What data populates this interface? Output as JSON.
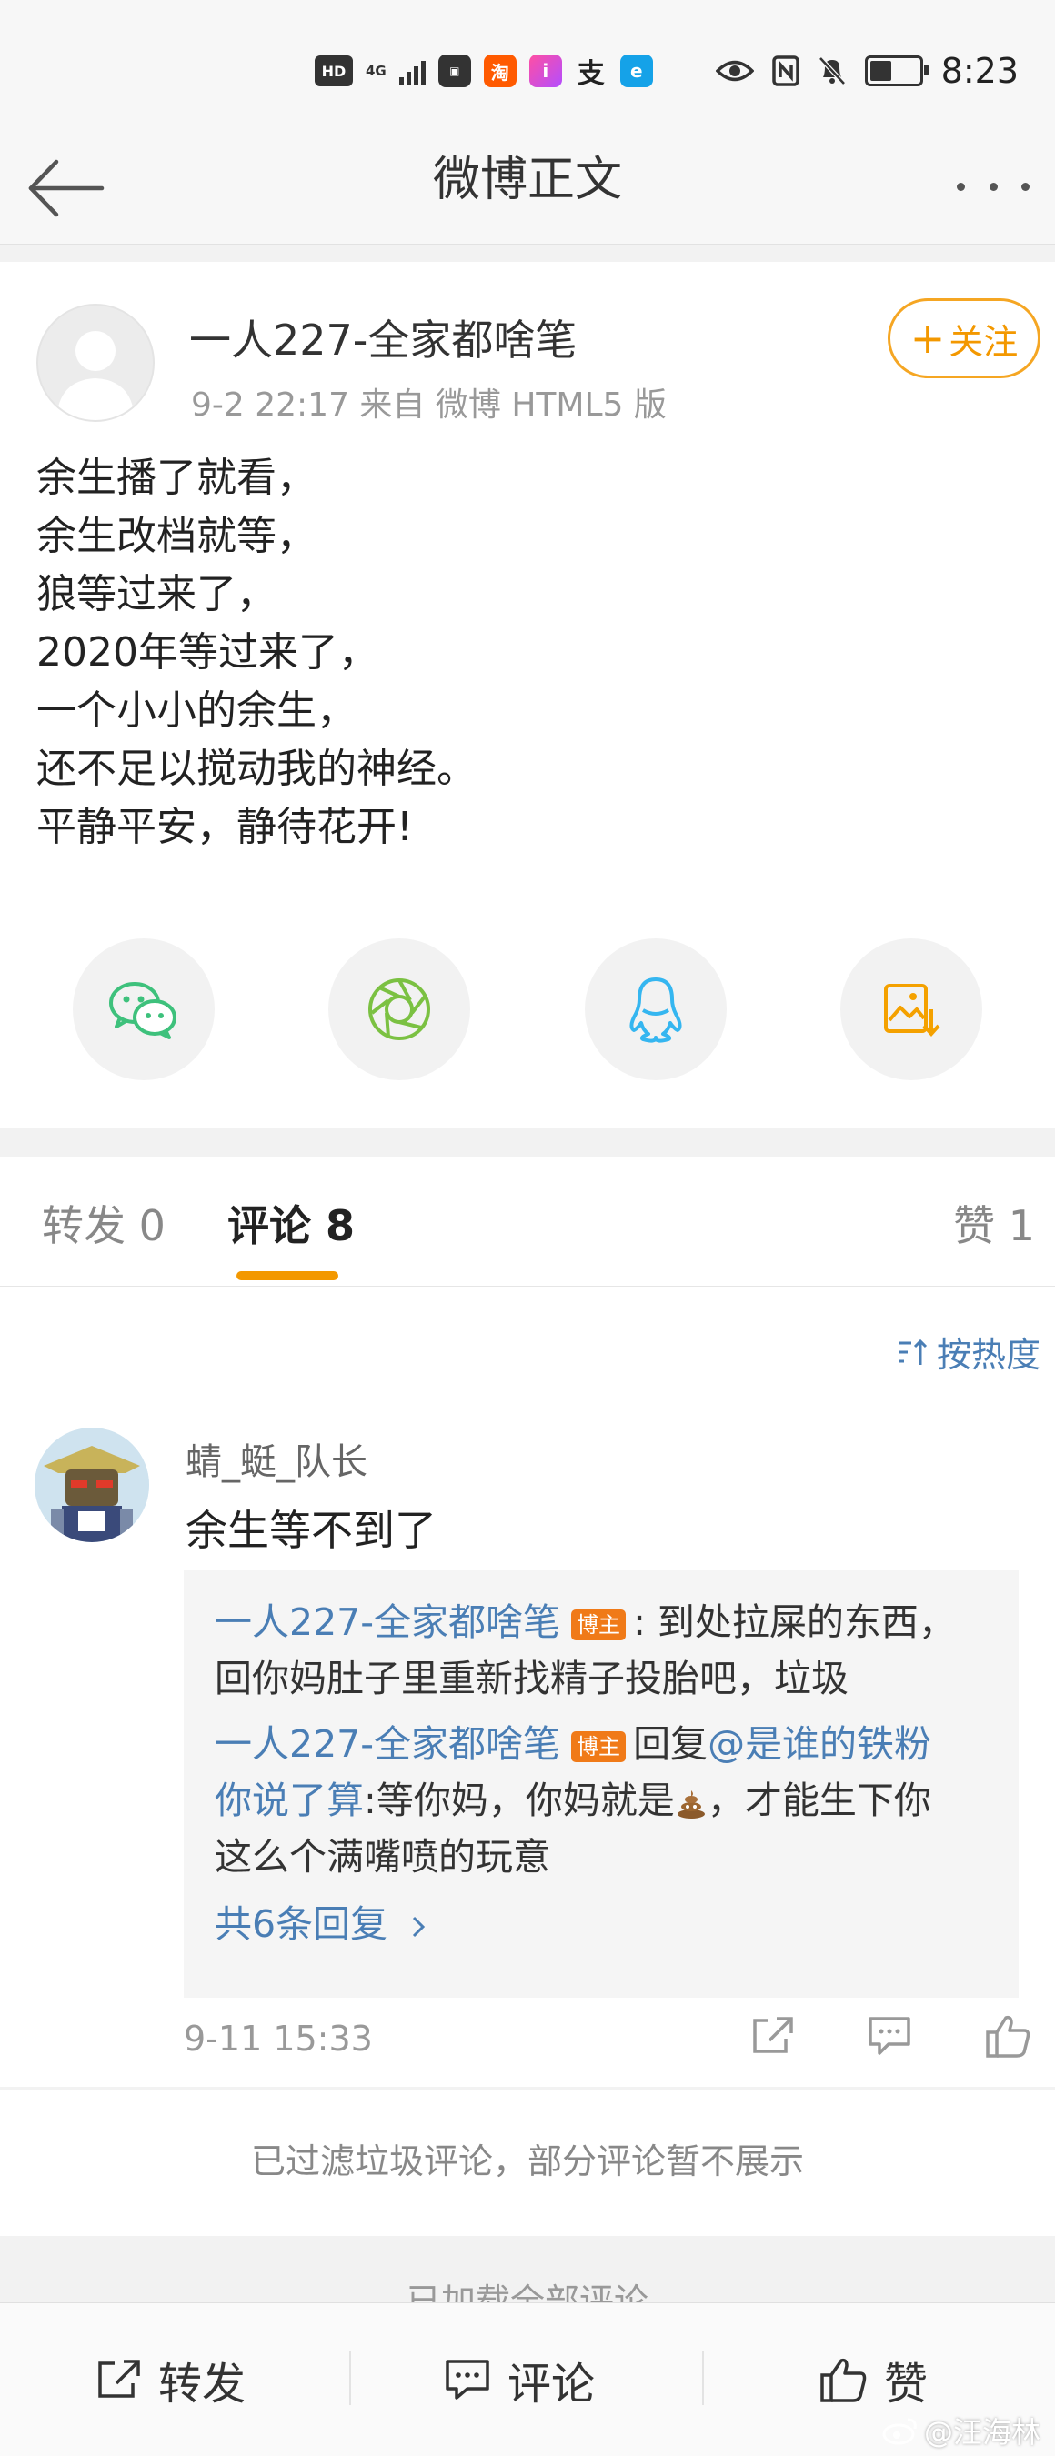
{
  "status_bar": {
    "hd": "HD",
    "network": "4G",
    "time": "8:23",
    "battery_level": 0.45,
    "icons_left": [
      "hd-icon",
      "4g-icon",
      "signal-icon",
      "huawei-icon",
      "taobao-icon",
      "app-i-icon",
      "alipay-icon",
      "app-e-icon"
    ],
    "icons_right": [
      "eye-icon",
      "nfc-icon",
      "mute-bell-icon",
      "battery-icon"
    ]
  },
  "nav": {
    "title": "微博正文"
  },
  "post": {
    "author": "一人227-全家都啥笔",
    "meta": "9-2 22:17   来自 微博 HTML5 版",
    "follow_label": "关注",
    "lines": [
      "余生播了就看，",
      "余生改档就等，",
      "狼等过来了，",
      "2020年等过来了，",
      "一个小小的余生，",
      "还不足以搅动我的神经。",
      "平静平安，静待花开!"
    ],
    "share_icons": [
      "wechat-icon",
      "moments-icon",
      "qq-icon",
      "save-image-icon"
    ],
    "share_colors": {
      "wechat": "#3ec17c",
      "moments": "#7bc142",
      "qq": "#35b6f0",
      "save": "#f4a100"
    }
  },
  "tabs": {
    "repost": "转发 0",
    "comment": "评论 8",
    "like": "赞 1"
  },
  "comments": {
    "sort_label": "按热度",
    "items": [
      {
        "user": "蜻_蜓_队长",
        "text": "余生等不到了",
        "time": "9-11 15:33",
        "replies": {
          "r1_user": "一人227-全家都啥笔",
          "tag": "博主",
          "r1_text_a": ": 到处拉屎的东西，",
          "r1_text_b": "回你妈肚子里重新找精子投胎吧，垃圾",
          "r2_user": "一人227-全家都啥笔",
          "r2_reply_word": "回复",
          "r2_mention_a": "@是谁的铁粉",
          "r2_mention_b": "你说了算",
          "r2_text_a": ":等你妈，你妈就是",
          "r2_text_b": "，才能生下你",
          "r2_text_c": "这么个满嘴喷的玩意",
          "more": "共6条回复"
        }
      }
    ],
    "filtered_notice": "已过滤垃圾评论，部分评论暂不展示",
    "loaded_all": "已加载全部评论"
  },
  "bottom_bar": {
    "repost": "转发",
    "comment": "评论",
    "like": "赞"
  },
  "watermark": "@汪海林",
  "colors": {
    "accent": "#f39800",
    "link": "#4a7eb5",
    "tag": "#f07a18"
  }
}
